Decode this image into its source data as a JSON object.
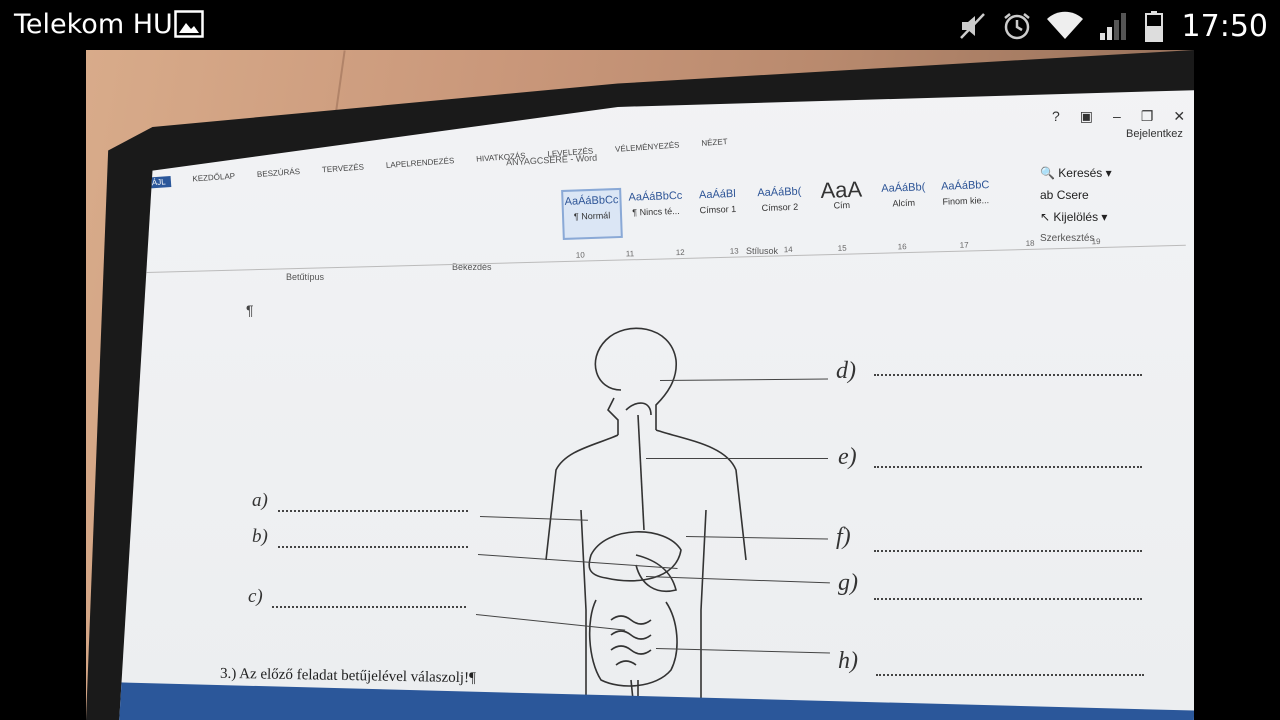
{
  "status_bar": {
    "carrier": "Telekom HU",
    "time": "17:50",
    "icons": [
      "gallery-icon",
      "mute-icon",
      "alarm-icon",
      "wifi-icon",
      "signal-icon",
      "battery-icon"
    ]
  },
  "word": {
    "window_title": "ANYAGCSERE - Word",
    "tabs": [
      "FÁJL",
      "KEZDŐLAP",
      "BESZÚRÁS",
      "TERVEZÉS",
      "LAPELRENDEZÉS",
      "HIVATKOZÁS",
      "LEVELEZÉS",
      "VÉLEMÉNYEZÉS",
      "NÉZET"
    ],
    "sign_in": "Bejelentkez",
    "styles": [
      {
        "sample": "AaÁáBbCc",
        "label": "¶ Normál"
      },
      {
        "sample": "AaÁáBbCc",
        "label": "¶ Nincs té..."
      },
      {
        "sample": "AaÁáBl",
        "label": "Címsor 1"
      },
      {
        "sample": "AaÁáBb(",
        "label": "Címsor 2"
      },
      {
        "sample": "AaA",
        "label": "Cím"
      },
      {
        "sample": "AaÁáBb(",
        "label": "Alcím"
      },
      {
        "sample": "AaÁáBbC",
        "label": "Finom kie..."
      }
    ],
    "group_styles": "Stílusok",
    "group_font": "Betűtípus",
    "group_paragraph": "Bekezdés",
    "editing": {
      "find": "Keresés",
      "replace": "Csere",
      "select": "Kijelölés",
      "group": "Szerkesztés"
    },
    "ruler_numbers": [
      "10",
      "11",
      "12",
      "13",
      "14",
      "15",
      "16",
      "17",
      "18",
      "19"
    ]
  },
  "document": {
    "pilcrow": "¶",
    "labels_left": [
      "a)",
      "b)",
      "c)"
    ],
    "labels_right": [
      "d)",
      "e)",
      "f)",
      "g)",
      "h)"
    ],
    "task_text": "3.) Az előző feladat betűjelével válaszolj!¶"
  },
  "colors": {
    "word_blue": "#2b579a",
    "screen_bg": "#eef0f2",
    "bezel": "#1a1a1a"
  }
}
